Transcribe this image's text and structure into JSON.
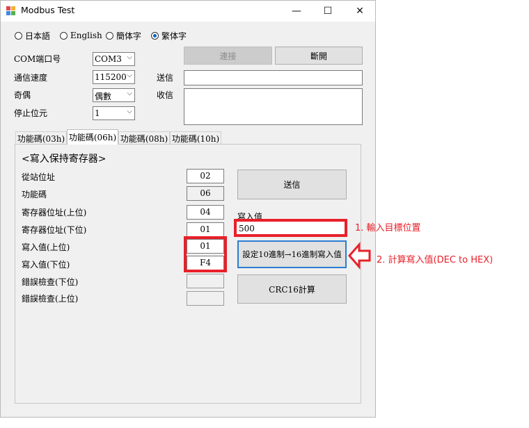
{
  "window": {
    "title": "Modbus Test",
    "controls": {
      "minimize": "—",
      "maximize": "☐",
      "close": "✕"
    }
  },
  "languages": [
    {
      "label": "日本語",
      "selected": false
    },
    {
      "label": "English",
      "selected": false
    },
    {
      "label": "簡体字",
      "selected": false
    },
    {
      "label": "繁体字",
      "selected": true
    }
  ],
  "connection": {
    "com_label": "COM端口号",
    "com_value": "COM3",
    "baud_label": "通信速度",
    "baud_value": "115200",
    "parity_label": "奇偶",
    "parity_value": "偶數",
    "stop_label": "停止位元",
    "stop_value": "1",
    "connect_label": "連接",
    "disconnect_label": "斷開",
    "send_label": "送信",
    "send_value": "",
    "recv_label": "收信",
    "recv_value": ""
  },
  "tabs": [
    {
      "label": "功能碼(03h)",
      "active": false
    },
    {
      "label": "功能碼(06h)",
      "active": true
    },
    {
      "label": "功能碼(08h)",
      "active": false
    },
    {
      "label": "功能碼(10h)",
      "active": false
    }
  ],
  "panel": {
    "heading": "<寫入保持寄存器>",
    "rows": [
      {
        "label": "從站位址",
        "value": "02"
      },
      {
        "label": "功能碼",
        "value": "06"
      },
      {
        "label": "寄存器位址(上位)",
        "value": "04"
      },
      {
        "label": "寄存器位址(下位)",
        "value": "01"
      },
      {
        "label": "寫入值(上位)",
        "value": "01"
      },
      {
        "label": "寫入值(下位)",
        "value": "F4"
      },
      {
        "label": "錯誤檢查(下位)",
        "value": ""
      },
      {
        "label": "錯誤檢查(上位)",
        "value": ""
      }
    ],
    "send_button": "送信",
    "write_value_label": "寫入值",
    "write_value": "500",
    "convert_button": "設定10進制→16進制寫入值",
    "crc_button": "CRC16計算"
  },
  "annotations": {
    "step1": "1. 輸入目標位置",
    "step2": "2. 計算寫入值(DEC to HEX)",
    "color": "#e8202a"
  }
}
